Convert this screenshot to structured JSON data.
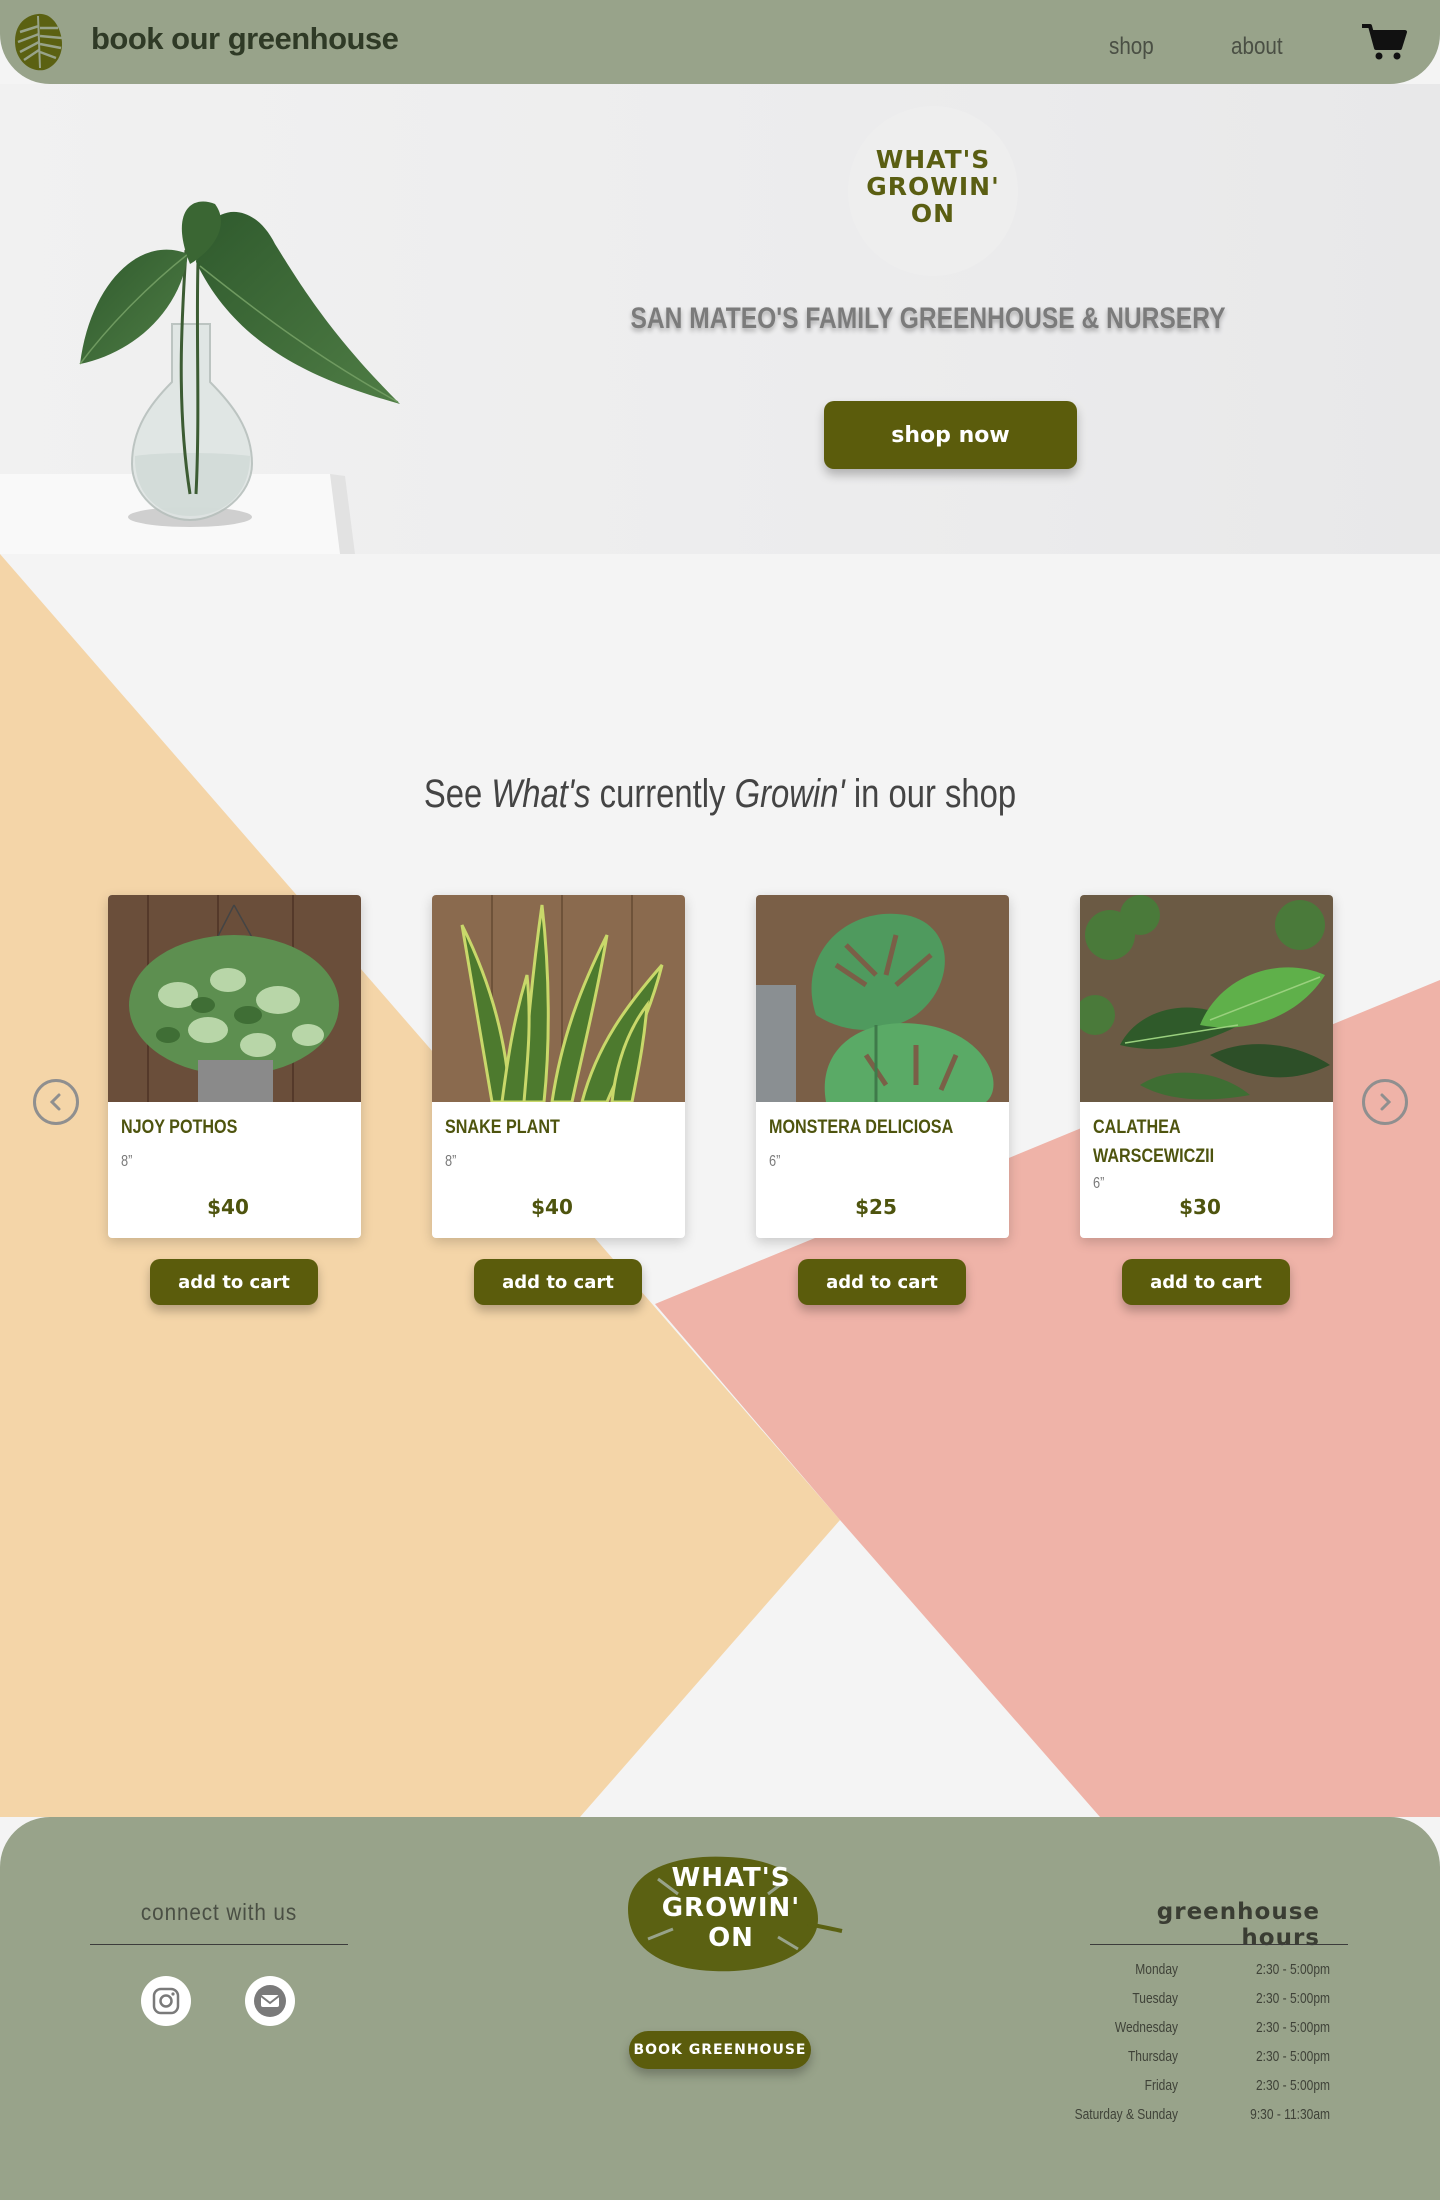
{
  "nav": {
    "brand": "book our greenhouse",
    "links": [
      "shop",
      "about"
    ]
  },
  "hero": {
    "badge_text": "WHAT'S\nGROWIN'\nON",
    "tagline": "SAN MATEO'S FAMILY GREENHOUSE & NURSERY",
    "cta": "shop now"
  },
  "shop": {
    "title_parts": [
      "See ",
      "What's",
      " currently ",
      "Growin'",
      " in our shop"
    ],
    "products": [
      {
        "name": "NJOY POTHOS",
        "size": "8”",
        "price": "$40",
        "cta": "add to cart"
      },
      {
        "name": "SNAKE PLANT",
        "size": "8”",
        "price": "$40",
        "cta": "add to cart"
      },
      {
        "name": "MONSTERA DELICIOSA",
        "size": "6”",
        "price": "$25",
        "cta": "add to cart"
      },
      {
        "name": "CALATHEA WARSCEWICZII",
        "size": "6”",
        "price": "$30",
        "cta": "add to cart"
      }
    ]
  },
  "footer": {
    "connect_title": "connect with us",
    "logo_text": "WHAT'S\nGROWIN'\nON",
    "book_button": "BOOK GREENHOUSE",
    "hours_title": "greenhouse hours",
    "hours": [
      {
        "day": "Monday",
        "time": "2:30 - 5:00pm"
      },
      {
        "day": "Tuesday",
        "time": "2:30 - 5:00pm"
      },
      {
        "day": "Wednesday",
        "time": "2:30 - 5:00pm"
      },
      {
        "day": "Thursday",
        "time": "2:30 - 5:00pm"
      },
      {
        "day": "Friday",
        "time": "2:30 - 5:00pm"
      },
      {
        "day": "Saturday & Sunday",
        "time": "9:30 - 11:30am"
      }
    ]
  },
  "colors": {
    "nav_bg": "#98a38a",
    "button": "#5b5c0c",
    "peach": "#f4d5a8",
    "salmon": "#efb3a8"
  },
  "icons": [
    "monstera-leaf-icon",
    "cart-icon",
    "chevron-left-icon",
    "chevron-right-icon",
    "instagram-icon",
    "mail-icon"
  ]
}
